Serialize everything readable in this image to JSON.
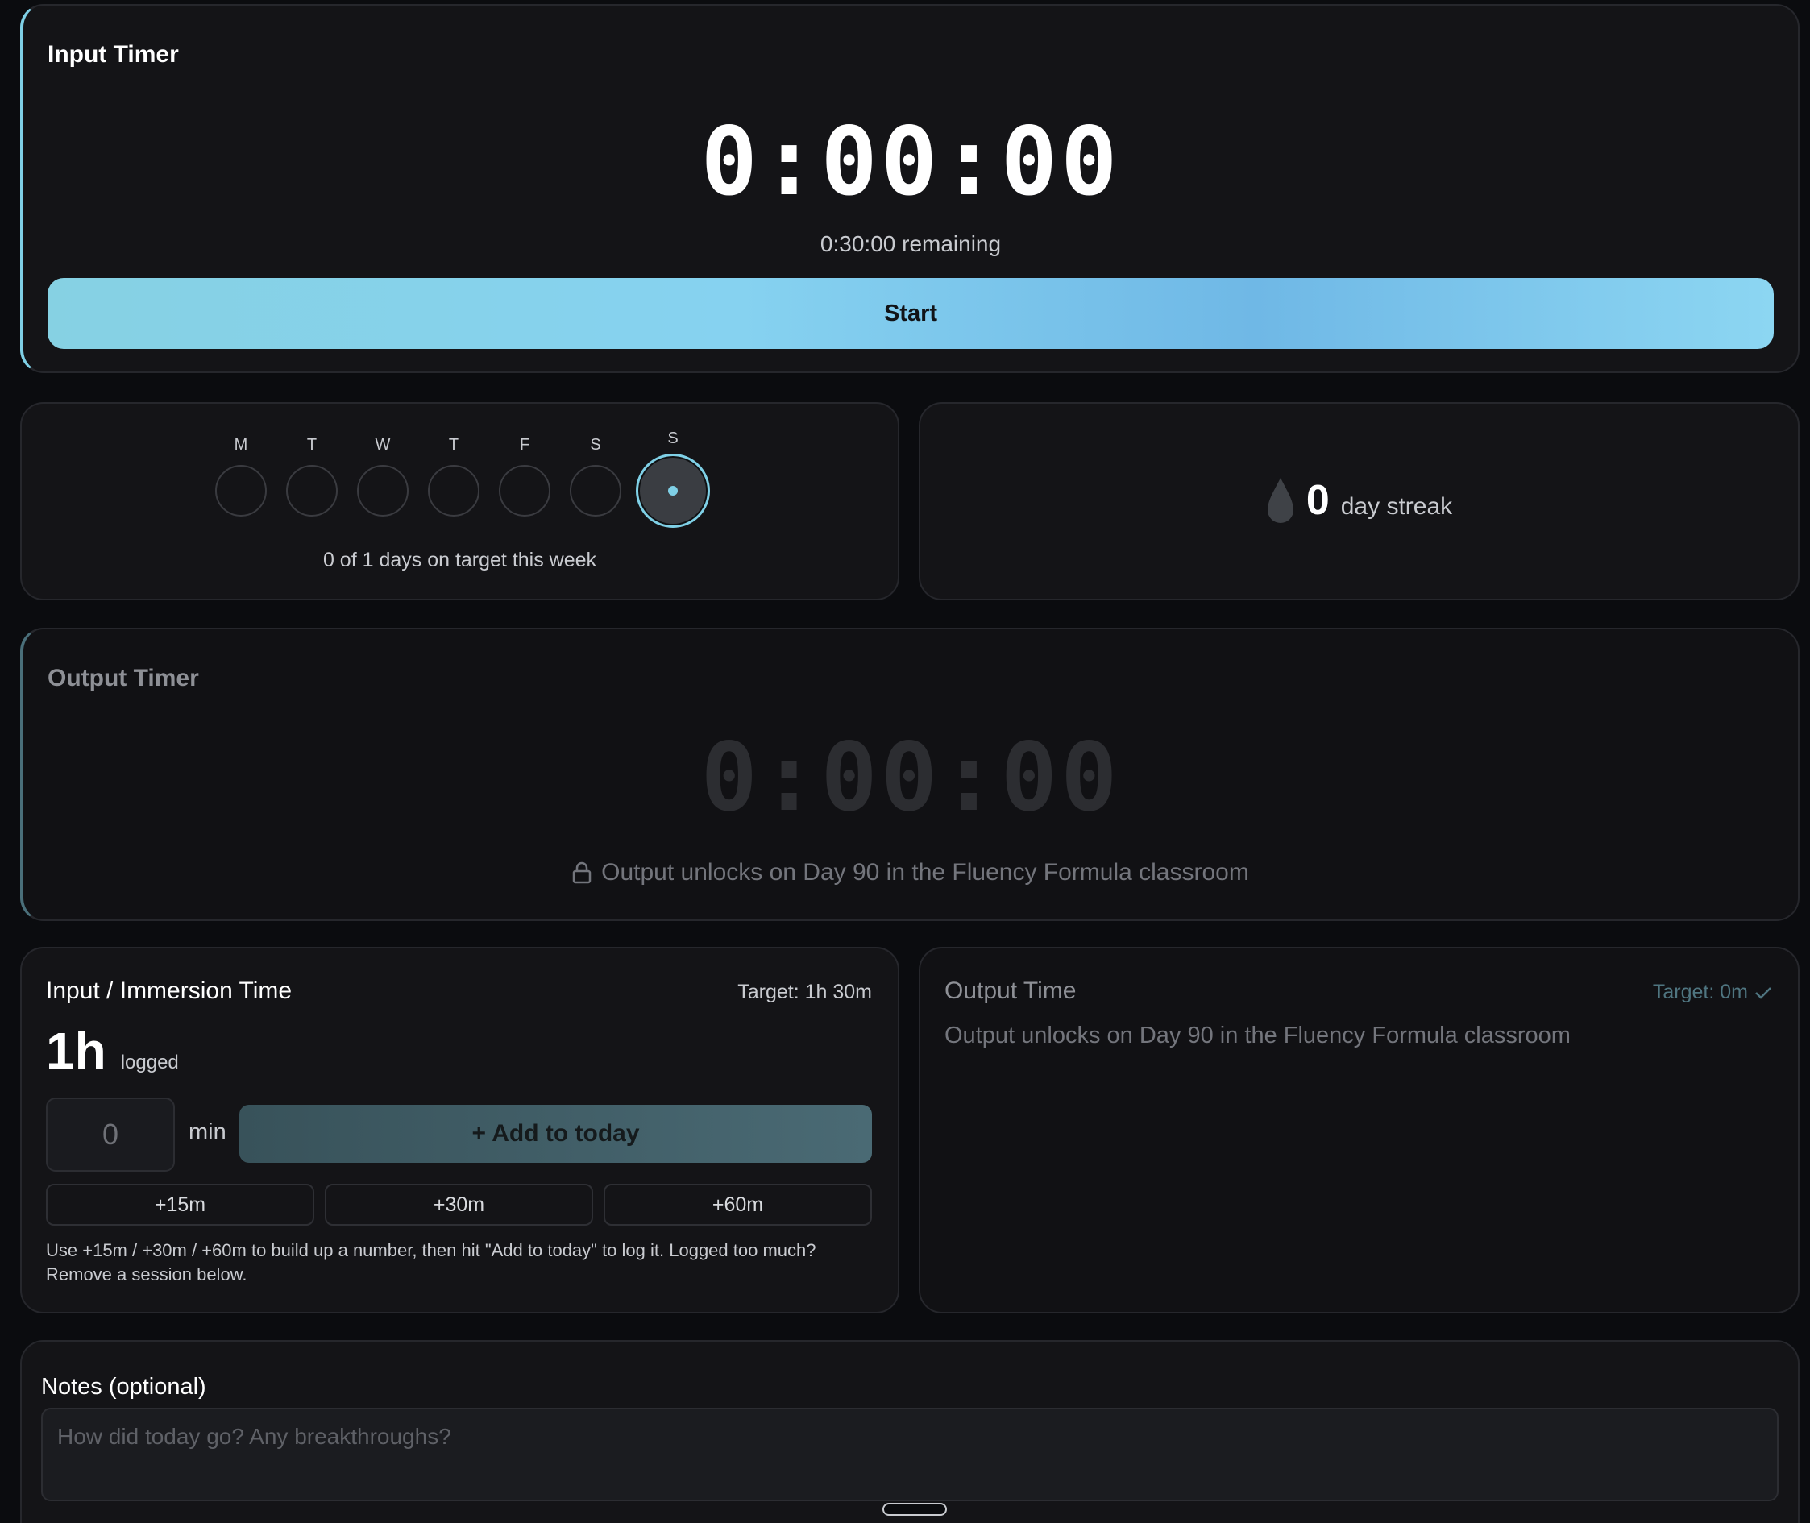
{
  "input_timer": {
    "title": "Input Timer",
    "time": "0:00:00",
    "remaining": "0:30:00 remaining",
    "start_label": "Start"
  },
  "week": {
    "days": [
      "M",
      "T",
      "W",
      "T",
      "F",
      "S",
      "S"
    ],
    "today_index": 6,
    "caption": "0 of 1 days on target this week"
  },
  "streak": {
    "count": "0",
    "label": "day streak",
    "icon": "drop-icon"
  },
  "output_timer": {
    "title": "Output Timer",
    "time": "0:00:00",
    "locked_message": "Output unlocks on Day 90 in the Fluency Formula classroom",
    "icon": "lock-icon"
  },
  "input_time": {
    "title": "Input / Immersion Time",
    "target": "Target: 1h 30m",
    "logged_value": "1h",
    "logged_label": "logged",
    "minutes_value": "0",
    "minutes_unit": "min",
    "add_label": "+ Add to today",
    "quick_add": [
      "+15m",
      "+30m",
      "+60m"
    ],
    "help_text": "Use +15m / +30m / +60m to build up a number, then hit \"Add to today\" to log it. Logged too much? Remove a session below."
  },
  "output_time": {
    "title": "Output Time",
    "target": "Target: 0m",
    "description": "Output unlocks on Day 90 in the Fluency Formula classroom",
    "icon": "check-icon"
  },
  "notes": {
    "title": "Notes (optional)",
    "placeholder": "How did today go? Any breakthroughs?"
  },
  "colors": {
    "accent": "#7fd0e6",
    "background": "#0b0c0f",
    "card": "#141417"
  }
}
